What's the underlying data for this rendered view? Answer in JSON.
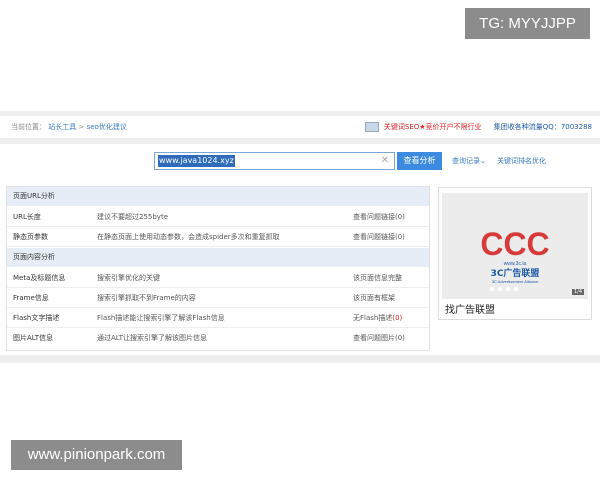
{
  "watermarks": {
    "top": "TG: MYYJJPP",
    "bottom": "www.pinionpark.com"
  },
  "breadcrumb": {
    "label": "当前位置：",
    "items": [
      "站长工具",
      ">",
      "seo优化建议"
    ]
  },
  "topbar": {
    "promo": "关键词SEO★竞价开户不限行业",
    "qq": "集团收各种流量QQ：7003288"
  },
  "search": {
    "value": "www.java1024.xyz",
    "button": "查看分析",
    "history": "查询记录⌄",
    "keyword_link": "关键词排名优化"
  },
  "sections": [
    {
      "title": "页面URL分析",
      "rows": [
        {
          "name": "URL长度",
          "advice": "建议不要超过255byte",
          "result": "查看问题链接(0)"
        },
        {
          "name": "静态页参数",
          "advice": "在静态页面上使用动态参数，会造成spider多次和重复抓取",
          "result": "查看问题链接(0)"
        }
      ]
    },
    {
      "title": "页面内容分析",
      "rows": [
        {
          "name": "Meta及标题信息",
          "advice": "搜索引擎优化的关键",
          "result": "该页面信息完整"
        },
        {
          "name": "Frame信息",
          "advice": "搜索引擎抓取不到Frame的内容",
          "result": "该页面有框架"
        },
        {
          "name": "Flash文字描述",
          "advice": "Flash描述能让搜索引擎了解该Flash信息",
          "result_prefix": "无Flash描述",
          "result_num": "(0)"
        },
        {
          "name": "图片ALT信息",
          "advice": "通过ALT让搜索引擎了解该图片信息",
          "result": "查看问题图片(0)"
        }
      ]
    }
  ],
  "ad": {
    "logo_text": "CCC",
    "logo_url": "www.3c.la",
    "logo_name": "3C广告联盟",
    "logo_sub": "3C Advertisement Alliance",
    "pager": "1/4",
    "caption": "找广告联盟"
  },
  "colors": {
    "accent": "#3c8be0",
    "link": "#3a7bc8",
    "warn": "#dd2222"
  }
}
